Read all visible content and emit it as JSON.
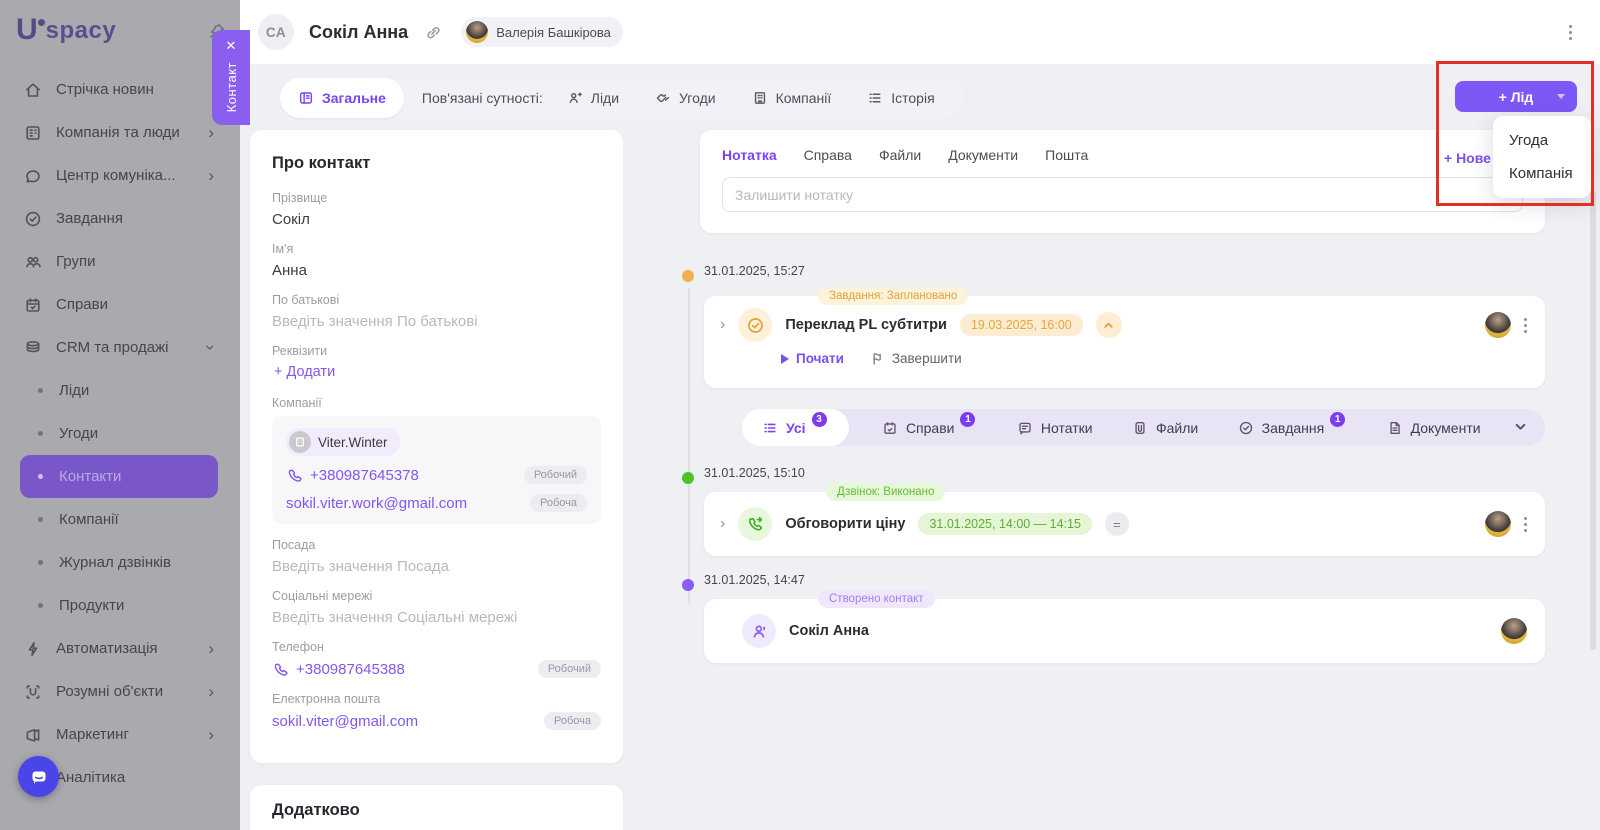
{
  "colors": {
    "accent": "#7a4ff2",
    "orange": "#e3a33c",
    "green": "#4fc226",
    "purple_badge": "#a37df5",
    "annotation_red": "#e33024"
  },
  "brand": {
    "logo_u": "U",
    "logo_rest": "spacy"
  },
  "slideover": {
    "tab_label": "Контакт"
  },
  "sidebar": {
    "items": [
      {
        "label": "Стрічка новин"
      },
      {
        "label": "Компанія та люди"
      },
      {
        "label": "Центр комуніка..."
      },
      {
        "label": "Завдання"
      },
      {
        "label": "Групи"
      },
      {
        "label": "Справи"
      },
      {
        "label": "CRM та продажі"
      },
      {
        "label": "Ліди"
      },
      {
        "label": "Угоди"
      },
      {
        "label": "Контакти"
      },
      {
        "label": "Компанії"
      },
      {
        "label": "Журнал дзвінків"
      },
      {
        "label": "Продукти"
      },
      {
        "label": "Автоматизація"
      },
      {
        "label": "Розумні об'єкти"
      },
      {
        "label": "Маркетинг"
      },
      {
        "label": "Аналітика"
      }
    ]
  },
  "header": {
    "avatar_initials": "СА",
    "contact_name": "Сокіл Анна",
    "owner_name": "Валерія Башкірова"
  },
  "tabs": {
    "general": "Загальне",
    "related_label": "Пов'язані сутності:",
    "leads": "Ліди",
    "deals": "Угоди",
    "companies": "Компанії",
    "history": "Історія"
  },
  "actions": {
    "add_lead": "+ Лід",
    "new_link": "+ Нове",
    "dropdown": {
      "deal": "Угода",
      "company": "Компанія"
    }
  },
  "about": {
    "title": "Про контакт",
    "last_name": {
      "label": "Прізвище",
      "value": "Сокіл"
    },
    "first_name": {
      "label": "Ім'я",
      "value": "Анна"
    },
    "middle_name": {
      "label": "По батькові",
      "placeholder": "Введіть значення По батькові"
    },
    "requisites": {
      "label": "Реквізити",
      "add": "+ Додати"
    },
    "companies": {
      "label": "Компанії",
      "company": "Viter.Winter",
      "phone": "+380987645378",
      "phone_badge": "Робочий",
      "email": "sokil.viter.work@gmail.com",
      "email_badge": "Робоча"
    },
    "position": {
      "label": "Посада",
      "placeholder": "Введіть значення Посада"
    },
    "social": {
      "label": "Соціальні мережі",
      "placeholder": "Введіть значення Соціальні мережі"
    },
    "phone": {
      "label": "Телефон",
      "value": "+380987645388",
      "badge": "Робочий"
    },
    "email": {
      "label": "Електронна пошта",
      "value": "sokil.viter@gmail.com",
      "badge": "Робоча"
    },
    "extra_title": "Додатково"
  },
  "composer": {
    "tabs": {
      "note": "Нотатка",
      "activity": "Справа",
      "files": "Файли",
      "documents": "Документи",
      "mail": "Пошта"
    },
    "placeholder": "Залишити нотатку"
  },
  "filter": {
    "all": "Усі",
    "all_count": "3",
    "activities": "Справи",
    "activities_count": "1",
    "notes": "Нотатки",
    "files": "Файли",
    "tasks": "Завдання",
    "tasks_count": "1",
    "documents": "Документи"
  },
  "timeline": {
    "entry1": {
      "date": "31.01.2025, 15:27",
      "badge": "Завдання: Заплановано",
      "title": "Переклад PL субтитри",
      "due": "19.03.2025, 16:00",
      "start": "Почати",
      "finish": "Завершити"
    },
    "entry2": {
      "date": "31.01.2025, 15:10",
      "badge": "Дзвінок: Виконано",
      "title": "Обговорити ціну",
      "period": "31.01.2025, 14:00 — 14:15"
    },
    "entry3": {
      "date": "31.01.2025, 14:47",
      "badge": "Створено контакт",
      "title": "Сокіл Анна"
    }
  }
}
